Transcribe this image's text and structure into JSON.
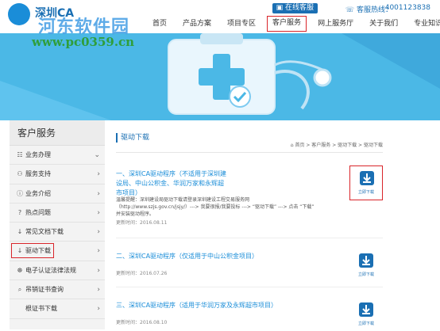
{
  "header": {
    "logo_text": "深圳CA",
    "watermark": "河东软件园",
    "watermark_url": "www.pc0359.cn",
    "online_label": "在线客服",
    "hotline_label": "客服热线：",
    "hotline_number": "4001123838",
    "nav": [
      {
        "label": "首页"
      },
      {
        "label": "产品方案"
      },
      {
        "label": "项目专区"
      },
      {
        "label": "客户服务"
      },
      {
        "label": "网上服务厅"
      },
      {
        "label": "关于我们"
      },
      {
        "label": "专业知识"
      }
    ],
    "active_nav": 3
  },
  "sidebar": {
    "title": "客户服务",
    "items": [
      {
        "icon": "☷",
        "label": "业务办理",
        "arrow": "⌄"
      },
      {
        "icon": "⚇",
        "label": "服务支持",
        "arrow": "›"
      },
      {
        "icon": "ⓘ",
        "label": "业务介绍",
        "arrow": "›"
      },
      {
        "icon": "?",
        "label": "热点问题",
        "arrow": "›"
      },
      {
        "icon": "↓",
        "label": "常见文档下载",
        "arrow": "›"
      },
      {
        "icon": "↓",
        "label": "驱动下载",
        "arrow": "›"
      },
      {
        "icon": "☸",
        "label": "电子认证法律法规",
        "arrow": "›"
      },
      {
        "icon": "⌕",
        "label": "吊销证书查询",
        "arrow": "›"
      },
      {
        "icon": "",
        "label": "根证书下载",
        "arrow": "›"
      }
    ],
    "active_item": 5
  },
  "content": {
    "section_title": "驱动下载",
    "breadcrumb": "首页 > 客户服务 > 驱动下载 > 驱动下载",
    "items": [
      {
        "title": "一、深圳CA驱动程序（不适用于深圳建设局、中山公积金、华润万家和永辉超市项目）",
        "desc": "温馨提醒：深圳建设局驱动下载请登录深圳建设工程交易服务网（http://www.szjs.gov.cn/jsjy/）---> 我要很报/我要投标 ---> “驱动下载” ---> 点击 “下载” 并安装驱动程序。",
        "date": "更新时间：2016.08.11",
        "button": "立即下载"
      },
      {
        "title": "二、深圳CA驱动程序（仅适用于中山公积金项目）",
        "desc": "",
        "date": "更新时间：2016.07.26",
        "button": "立即下载"
      },
      {
        "title": "三、深圳CA驱动程序（适用于华润万家及永辉超市项目）",
        "desc": "",
        "date": "更新时间：2016.08.10",
        "button": "立即下载"
      }
    ]
  },
  "colors": {
    "accent": "#1a6fb3",
    "link": "#1a8dd8",
    "highlight_frame": "#d9252a",
    "banner": "#4bb8e6"
  }
}
